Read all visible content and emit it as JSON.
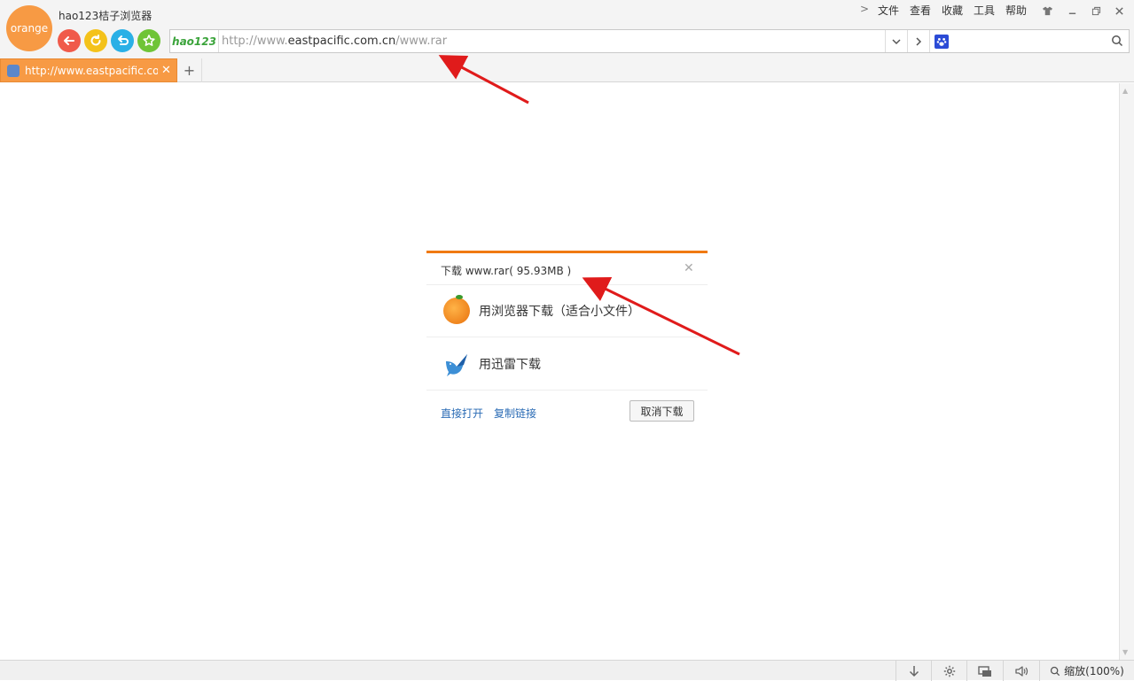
{
  "app": {
    "logo_text": "orange",
    "title": "hao123桔子浏览器"
  },
  "menu": {
    "items": [
      "文件",
      "查看",
      "收藏",
      "工具",
      "帮助"
    ]
  },
  "address_bar": {
    "logo": "hao123",
    "url_prefix": "http://www.",
    "url_domain": "eastpacific.com.cn",
    "url_suffix": "/www.rar"
  },
  "tab": {
    "title": "http://www.eastpacific.com.cn",
    "new_tab_label": "+"
  },
  "download_dialog": {
    "title_prefix": "下载",
    "file_name": "www.rar",
    "file_size": "( 95.93MB )",
    "option_browser": "用浏览器下载（适合小文件）",
    "option_xunlei": "用迅雷下载",
    "link_open": "直接打开",
    "link_copy": "复制链接",
    "cancel_label": "取消下载"
  },
  "statusbar": {
    "zoom_label": "缩放(100%)"
  },
  "colors": {
    "accent": "#f79a44",
    "dialog_border": "#f07a12",
    "annotation_arrow": "#e01b1b",
    "link": "#2a6bb5"
  }
}
